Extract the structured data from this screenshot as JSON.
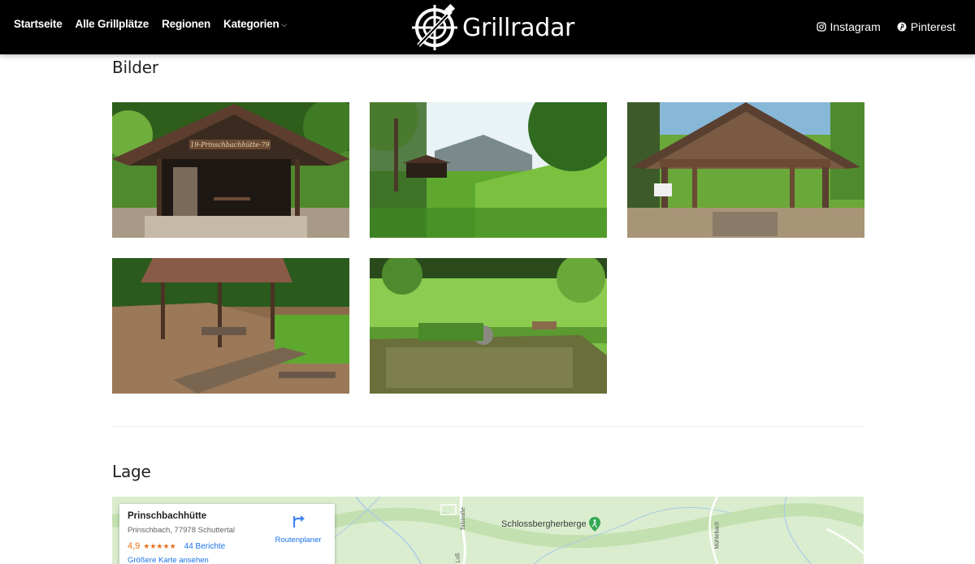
{
  "header": {
    "nav": [
      {
        "label": "Startseite"
      },
      {
        "label": "Alle Grillplätze"
      },
      {
        "label": "Regionen"
      },
      {
        "label": "Kategorien",
        "has_dropdown": true
      }
    ],
    "logo_text": "Grillradar",
    "social": [
      {
        "label": "Instagram",
        "icon": "instagram-icon"
      },
      {
        "label": "Pinterest",
        "icon": "pinterest-icon"
      }
    ]
  },
  "sections": {
    "images_title": "Bilder",
    "location_title": "Lage"
  },
  "gallery": [
    {
      "name": "gallery-image-1",
      "sign_text": "19-Prinschbachhütte-79"
    },
    {
      "name": "gallery-image-2"
    },
    {
      "name": "gallery-image-3"
    },
    {
      "name": "gallery-image-4"
    },
    {
      "name": "gallery-image-5"
    }
  ],
  "map": {
    "place_name": "Prinschbachhütte",
    "address": "Prinschbach, 77978 Schuttertal",
    "rating": "4,9",
    "stars": "★★★★★",
    "reviews": "44 Berichte",
    "bigger_map": "Größere Karte ansehen",
    "route_label": "Routenplaner",
    "poi_label": "Schlossbergherberge",
    "road_labels": [
      "Talstraße",
      "Mühlebach",
      "Luß"
    ]
  },
  "colors": {
    "header_bg": "#000000",
    "link_blue": "#1a73e8",
    "star_orange": "#e7711b",
    "map_green": "#dbedcf"
  }
}
